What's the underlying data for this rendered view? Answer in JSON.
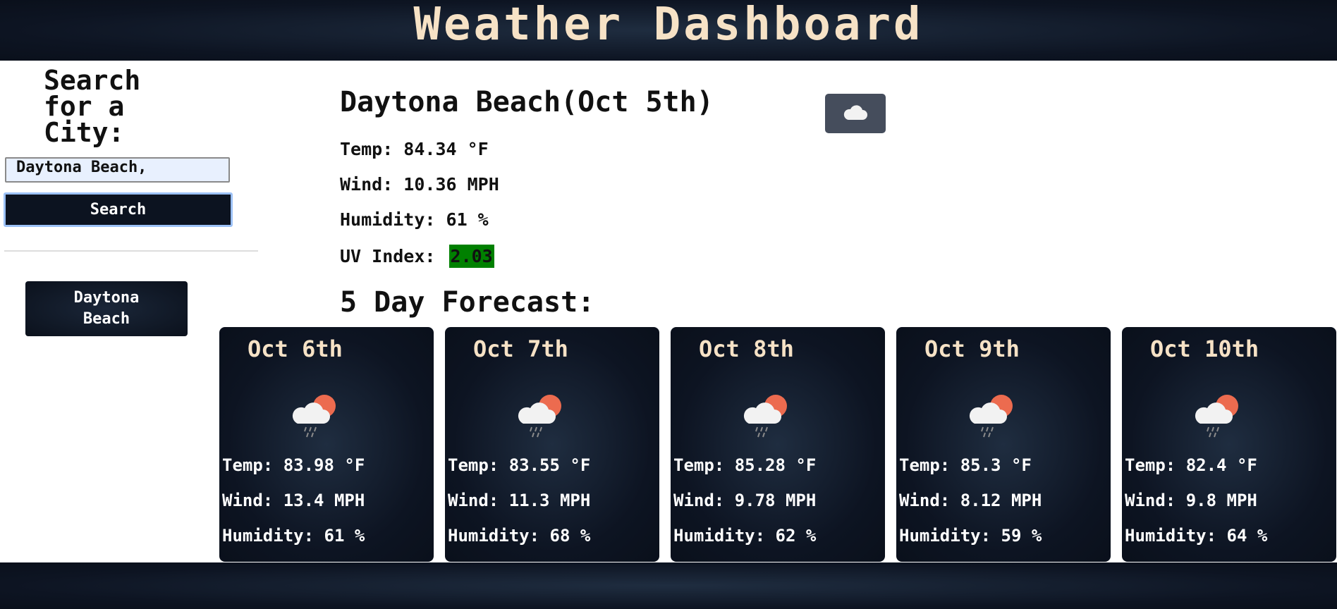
{
  "header": {
    "title": "Weather Dashboard"
  },
  "sidebar": {
    "search_title": "Search for a City:",
    "search_input_value": "Daytona Beach,",
    "search_button_label": "Search",
    "history": [
      {
        "label": "Daytona Beach"
      }
    ]
  },
  "current": {
    "title": "Daytona Beach(Oct 5th)",
    "icon": "cloud-icon",
    "temp": "Temp: 84.34 °F",
    "wind": "Wind: 10.36 MPH",
    "humidity": "Humidity: 61 %",
    "uv_label": "UV Index:",
    "uv_value": "2.03",
    "uv_color": "#008000"
  },
  "forecast": {
    "title": "5 Day Forecast:",
    "days": [
      {
        "date": "Oct 6th",
        "icon": "rain-sun-cloud-icon",
        "temp": "Temp: 83.98 °F",
        "wind": "Wind: 13.4 MPH",
        "humidity": "Humidity: 61 %"
      },
      {
        "date": "Oct 7th",
        "icon": "rain-sun-cloud-icon",
        "temp": "Temp: 83.55 °F",
        "wind": "Wind: 11.3 MPH",
        "humidity": "Humidity: 68 %"
      },
      {
        "date": "Oct 8th",
        "icon": "rain-sun-cloud-icon",
        "temp": "Temp: 85.28 °F",
        "wind": "Wind: 9.78 MPH",
        "humidity": "Humidity: 62 %"
      },
      {
        "date": "Oct 9th",
        "icon": "rain-sun-cloud-icon",
        "temp": "Temp: 85.3 °F",
        "wind": "Wind: 8.12 MPH",
        "humidity": "Humidity: 59 %"
      },
      {
        "date": "Oct 10th",
        "icon": "rain-sun-cloud-icon",
        "temp": "Temp: 82.4 °F",
        "wind": "Wind: 9.8 MPH",
        "humidity": "Humidity: 64 %"
      }
    ]
  },
  "colors": {
    "header_bg": "#0d1422",
    "title_cream": "#f6e2c6",
    "button_border": "#9cc1f6",
    "input_bg": "#e8f0fe"
  }
}
